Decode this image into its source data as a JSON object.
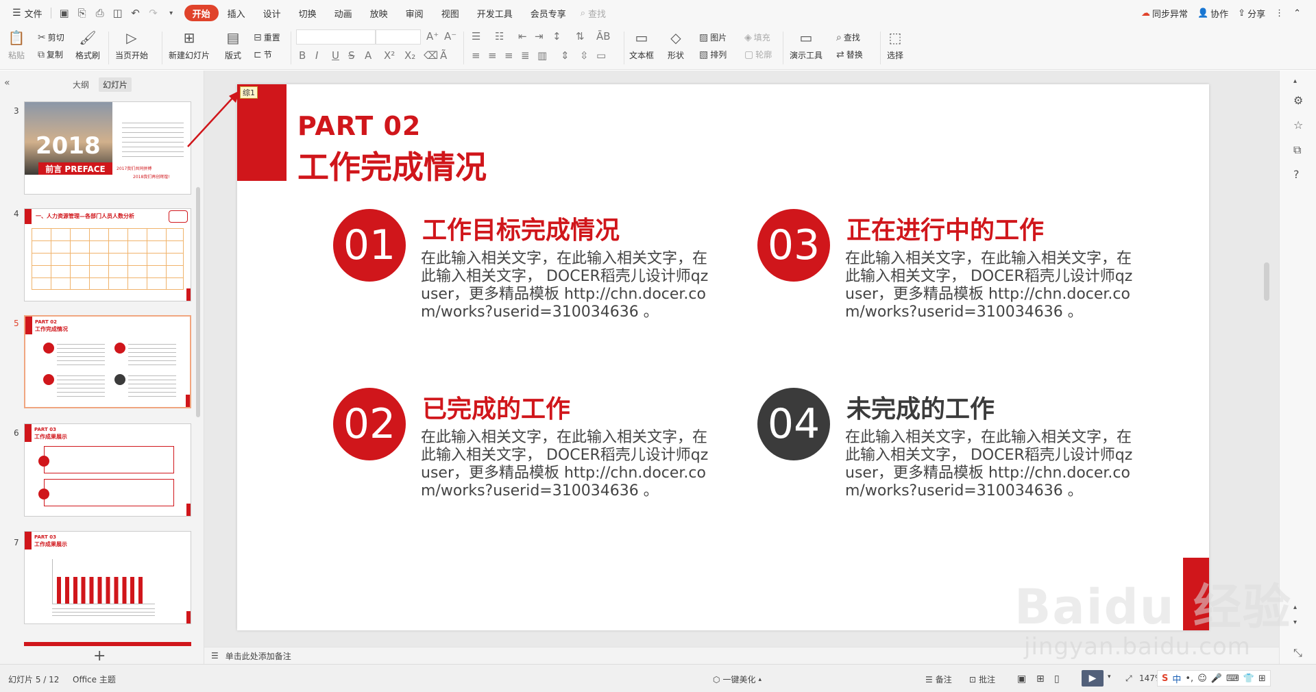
{
  "menubar": {
    "file_label": "文件",
    "tabs": [
      {
        "label": "开始",
        "active": true
      },
      {
        "label": "插入"
      },
      {
        "label": "设计"
      },
      {
        "label": "切换"
      },
      {
        "label": "动画"
      },
      {
        "label": "放映"
      },
      {
        "label": "审阅"
      },
      {
        "label": "视图"
      },
      {
        "label": "开发工具"
      },
      {
        "label": "会员专享"
      }
    ],
    "search_label": "查找",
    "sync_label": "同步异常",
    "collab_label": "协作",
    "share_label": "分享"
  },
  "ribbon": {
    "paste": "粘贴",
    "cut": "剪切",
    "copy": "复制",
    "format_painter": "格式刷",
    "start_slideshow": "当页开始",
    "new_slide": "新建幻灯片",
    "layout": "版式",
    "reset": "重置",
    "section": "节",
    "textbox": "文本框",
    "shape": "形状",
    "picture": "图片",
    "fill": "填充",
    "arrange": "排列",
    "outline": "轮廓",
    "presentation_tools": "演示工具",
    "find": "查找",
    "replace": "替换",
    "select": "选择"
  },
  "leftpanel": {
    "tab_outline": "大纲",
    "tab_slides": "幻灯片",
    "thumbs": [
      {
        "num": "3",
        "text_a": "前言 PREFACE",
        "text_b": "2017我们共同拼搏",
        "text_c": "2018我们再创辉煌!"
      },
      {
        "num": "4",
        "text_a": "一、人力资源管理—各部门人员人数分析"
      },
      {
        "num": "5",
        "text_a": "PART 02",
        "text_b": "工作完成情况"
      },
      {
        "num": "6",
        "text_a": "PART 03",
        "text_b": "工作成果展示"
      },
      {
        "num": "7",
        "text_a": "PART 03",
        "text_b": "工作成果展示"
      }
    ]
  },
  "slide": {
    "comment_tag": "综1",
    "part": "PART 02",
    "title": "工作完成情况",
    "items": [
      {
        "num": "01",
        "title": "工作目标完成情况",
        "body": "在此输入相关文字，在此输入相关文字，在此输入相关文字， DOCER稻壳儿设计师qzuser，更多精品模板 http://chn.docer.com/works?userid=310034636 。"
      },
      {
        "num": "03",
        "title": "正在进行中的工作",
        "body": "在此输入相关文字，在此输入相关文字，在此输入相关文字， DOCER稻壳儿设计师qzuser，更多精品模板 http://chn.docer.com/works?userid=310034636 。"
      },
      {
        "num": "02",
        "title": "已完成的工作",
        "body": "在此输入相关文字，在此输入相关文字，在此输入相关文字， DOCER稻壳儿设计师qzuser，更多精品模板 http://chn.docer.com/works?userid=310034636 。"
      },
      {
        "num": "04",
        "title": "未完成的工作",
        "body": "在此输入相关文字，在此输入相关文字，在此输入相关文字， DOCER稻壳儿设计师qzuser，更多精品模板 http://chn.docer.com/works?userid=310034636 。"
      }
    ]
  },
  "notes": {
    "placeholder": "单击此处添加备注"
  },
  "statusbar": {
    "slide_count": "幻灯片 5 / 12",
    "theme": "Office 主题",
    "beautify": "一键美化",
    "notes": "备注",
    "comment": "批注",
    "zoom": "147%",
    "ime_lang": "中"
  },
  "watermark": {
    "brand": "Baidu 经验",
    "url": "jingyan.baidu.com"
  },
  "colors": {
    "accent": "#d0161b",
    "dark": "#3b3b3b",
    "tab_active": "#e0432b"
  }
}
